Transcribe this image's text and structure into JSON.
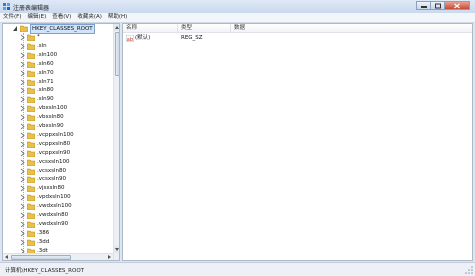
{
  "window": {
    "title": "注册表编辑器"
  },
  "menu": [
    "文件(F)",
    "编辑(E)",
    "查看(V)",
    "收藏夹(A)",
    "帮助(H)"
  ],
  "tree": {
    "root": "HKEY_CLASSES_ROOT",
    "items": [
      "*",
      ".sln",
      ".sln100",
      ".sln60",
      ".sln70",
      ".sln71",
      ".sln80",
      ".sln90",
      ".vbxsln100",
      ".vbxsln80",
      ".vbxsln90",
      ".vcppxsln100",
      ".vcppxsln80",
      ".vcppxsln90",
      ".vcsxsln100",
      ".vcsxsln80",
      ".vcsxsln90",
      ".vjsxsln80",
      ".vpdxsln100",
      ".vwdxsln100",
      ".vwdxsln80",
      ".vwdxsln90",
      ".386",
      ".3dd",
      ".3dt"
    ]
  },
  "values": {
    "columns": [
      "名称",
      "类型",
      "数据"
    ],
    "rows": [
      {
        "name": "(默认)",
        "type": "REG_SZ",
        "data": ""
      }
    ]
  },
  "status": {
    "path": "计算机\\HKEY_CLASSES_ROOT"
  }
}
